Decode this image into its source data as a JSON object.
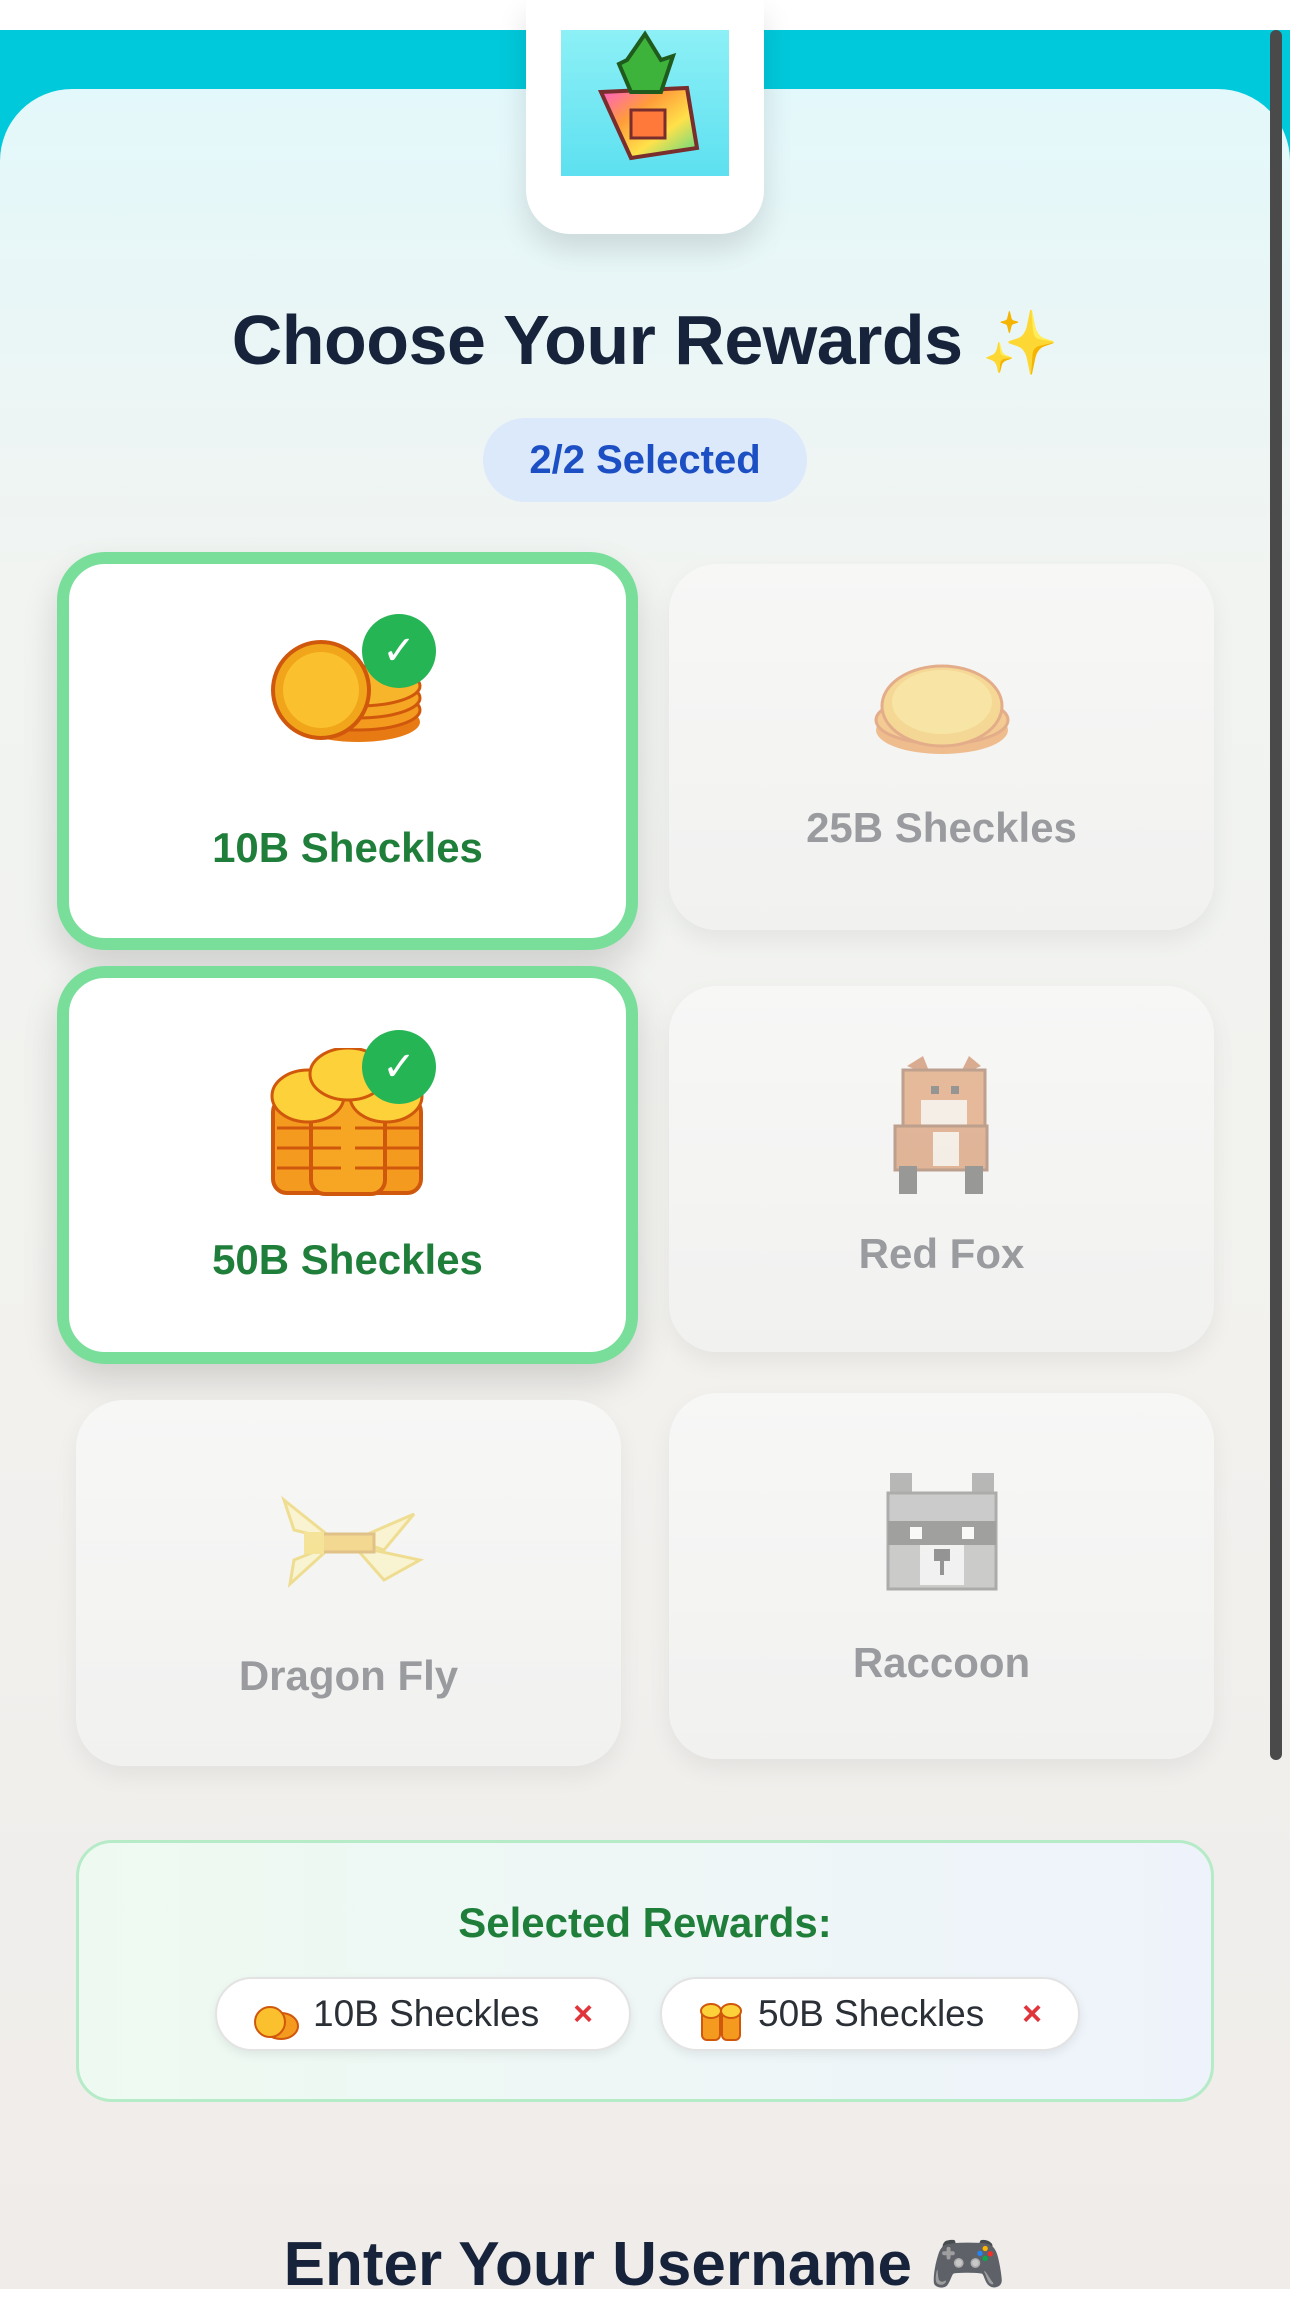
{
  "header": {
    "title": "Choose Your Rewards",
    "title_emoji": "✨",
    "selected_badge": "2/2 Selected"
  },
  "rewards": [
    {
      "label": "10B Sheckles",
      "selected": true,
      "icon": "coin-stack-icon"
    },
    {
      "label": "25B Sheckles",
      "selected": false,
      "icon": "coin-stack-icon"
    },
    {
      "label": "50B Sheckles",
      "selected": true,
      "icon": "coin-pile-icon"
    },
    {
      "label": "Red Fox",
      "selected": false,
      "icon": "red-fox-icon"
    },
    {
      "label": "Dragon Fly",
      "selected": false,
      "icon": "dragonfly-icon"
    },
    {
      "label": "Raccoon",
      "selected": false,
      "icon": "raccoon-icon"
    }
  ],
  "summary": {
    "title": "Selected Rewards:",
    "chips": [
      {
        "label": "10B Sheckles",
        "remove": "×"
      },
      {
        "label": "50B Sheckles",
        "remove": "×"
      }
    ]
  },
  "next_section": {
    "heading": "Enter Your Username 🎮"
  },
  "colors": {
    "accent_cyan": "#00c9db",
    "selected_border": "#79de9a",
    "selected_text": "#1f7f3a",
    "check_green": "#25b554",
    "badge_bg": "#dce9fb",
    "badge_text": "#1d4fc4",
    "remove_red": "#e0353b"
  }
}
